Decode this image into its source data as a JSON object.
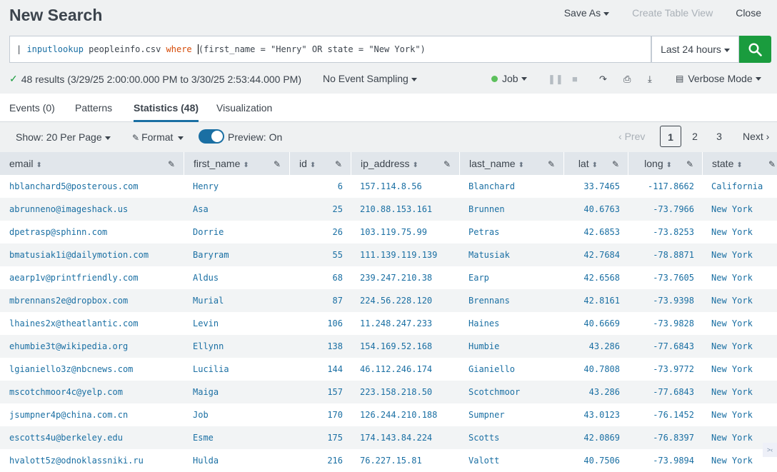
{
  "header": {
    "title": "New Search",
    "save_as": "Save As",
    "create_table_view": "Create Table View",
    "close": "Close"
  },
  "search": {
    "pipe": "| ",
    "command": "inputlookup",
    "file": " peopleinfo.csv ",
    "keyword": "where",
    "space": " ",
    "expr_open": "(",
    "expr_rest": "first_name = \"Henry\" OR state = \"New York\")"
  },
  "timepicker": {
    "label": "Last 24 hours"
  },
  "status": {
    "results": "48 results (3/29/25 2:00:00.000 PM to 3/30/25 2:53:44.000 PM)",
    "sampling": "No Event Sampling",
    "job": "Job",
    "mode": "Verbose Mode"
  },
  "tabs": [
    {
      "label": "Events (0)"
    },
    {
      "label": "Patterns"
    },
    {
      "label": "Statistics (48)"
    },
    {
      "label": "Visualization"
    }
  ],
  "toolbar": {
    "show": "Show: 20 Per Page",
    "format": "Format",
    "preview": "Preview: On"
  },
  "pager": {
    "prev": "Prev",
    "pages": [
      "1",
      "2",
      "3"
    ],
    "current": "1",
    "next": "Next"
  },
  "columns": [
    "email",
    "first_name",
    "id",
    "ip_address",
    "last_name",
    "lat",
    "long",
    "state"
  ],
  "rows": [
    [
      "hblanchard5@posterous.com",
      "Henry",
      "6",
      "157.114.8.56",
      "Blanchard",
      "33.7465",
      "-117.8662",
      "California"
    ],
    [
      "abrunneno@imageshack.us",
      "Asa",
      "25",
      "210.88.153.161",
      "Brunnen",
      "40.6763",
      "-73.7966",
      "New York"
    ],
    [
      "dpetrasp@sphinn.com",
      "Dorrie",
      "26",
      "103.119.75.99",
      "Petras",
      "42.6853",
      "-73.8253",
      "New York"
    ],
    [
      "bmatusiak1i@dailymotion.com",
      "Baryram",
      "55",
      "111.139.119.139",
      "Matusiak",
      "42.7684",
      "-78.8871",
      "New York"
    ],
    [
      "aearp1v@printfriendly.com",
      "Aldus",
      "68",
      "239.247.210.38",
      "Earp",
      "42.6568",
      "-73.7605",
      "New York"
    ],
    [
      "mbrennans2e@dropbox.com",
      "Murial",
      "87",
      "224.56.228.120",
      "Brennans",
      "42.8161",
      "-73.9398",
      "New York"
    ],
    [
      "lhaines2x@theatlantic.com",
      "Levin",
      "106",
      "11.248.247.233",
      "Haines",
      "40.6669",
      "-73.9828",
      "New York"
    ],
    [
      "ehumbie3t@wikipedia.org",
      "Ellynn",
      "138",
      "154.169.52.168",
      "Humbie",
      "43.286",
      "-77.6843",
      "New York"
    ],
    [
      "lgianiello3z@nbcnews.com",
      "Lucilia",
      "144",
      "46.112.246.174",
      "Gianiello",
      "40.7808",
      "-73.9772",
      "New York"
    ],
    [
      "mscotchmoor4c@yelp.com",
      "Maiga",
      "157",
      "223.158.218.50",
      "Scotchmoor",
      "43.286",
      "-77.6843",
      "New York"
    ],
    [
      "jsumpner4p@china.com.cn",
      "Job",
      "170",
      "126.244.210.188",
      "Sumpner",
      "43.0123",
      "-76.1452",
      "New York"
    ],
    [
      "escotts4u@berkeley.edu",
      "Esme",
      "175",
      "174.143.84.224",
      "Scotts",
      "42.0869",
      "-76.8397",
      "New York"
    ],
    [
      "hvalott5z@odnoklassniki.ru",
      "Hulda",
      "216",
      "76.227.15.81",
      "Valott",
      "40.7506",
      "-73.9894",
      "New York"
    ]
  ],
  "colors": {
    "accent": "#1a6fa3",
    "search_green": "#1a9c3e",
    "header_bg": "#eff1f2"
  }
}
